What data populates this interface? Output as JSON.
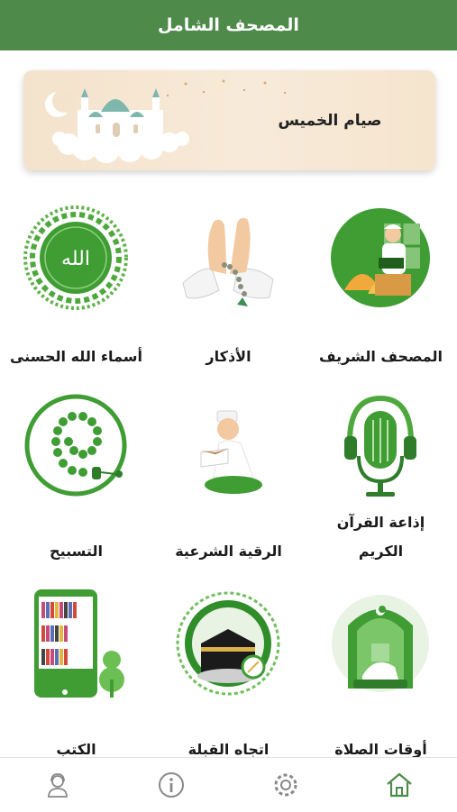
{
  "header": {
    "title": "المصحف الشامل"
  },
  "banner": {
    "text": "صيام الخميس"
  },
  "grid": {
    "items": [
      {
        "label": "المصحف الشريف",
        "icon": "quran-reader-icon"
      },
      {
        "label": "الأذكار",
        "icon": "praying-hands-icon"
      },
      {
        "label": "أسماء الله الحسنى",
        "icon": "allah-names-icon"
      },
      {
        "label_line1": "إذاعة القرآن",
        "label_line2": "الكريم",
        "icon": "microphone-icon"
      },
      {
        "label": "الرقية الشرعية",
        "icon": "ruqyah-reader-icon"
      },
      {
        "label": "التسبيح",
        "icon": "prayer-beads-icon"
      },
      {
        "label": "أوقات الصلاة",
        "icon": "prayer-times-icon"
      },
      {
        "label": "اتجاه القبلة",
        "icon": "kaaba-icon"
      },
      {
        "label": "الكتب",
        "icon": "books-icon"
      }
    ]
  },
  "nav": {
    "items": [
      "support-icon",
      "info-icon",
      "settings-icon",
      "home-icon"
    ]
  },
  "colors": {
    "brand": "#4e8a4a",
    "green": "#3f9d34",
    "dark_green": "#2f7d2a"
  }
}
